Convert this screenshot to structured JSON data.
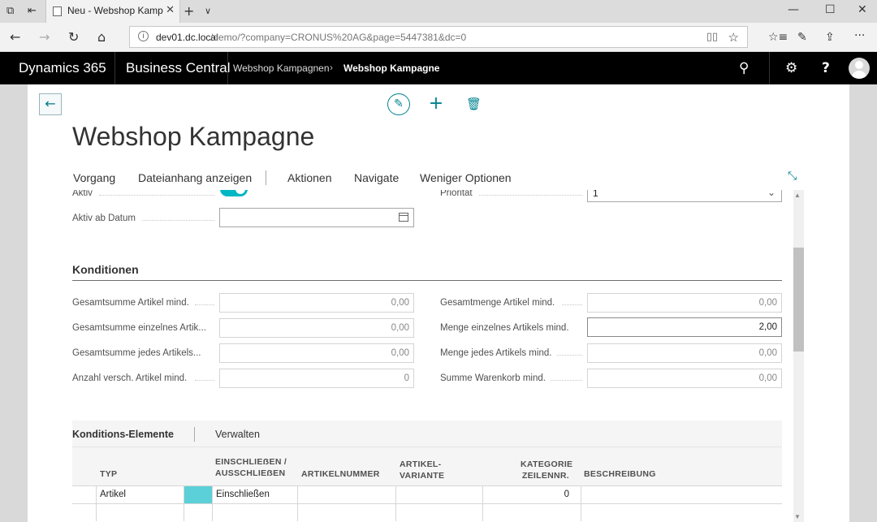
{
  "browser": {
    "tab_title": "Neu - Webshop Kampagne",
    "url_host": "dev01.dc.local",
    "url_path": "/demo/?company=CRONUS%20AG&page=5447381&dc=0"
  },
  "app": {
    "product": "Dynamics 365",
    "app_name": "Business Central",
    "breadcrumb": [
      "Webshop Kampagnen",
      "Webshop Kampagne"
    ]
  },
  "page": {
    "title": "Webshop Kampagne",
    "menu": [
      "Vorgang",
      "Dateianhang anzeigen",
      "Aktionen",
      "Navigate",
      "Weniger Optionen"
    ]
  },
  "general": {
    "aktiv_label": "Aktiv",
    "aktiv_value": true,
    "aktiv_ab_label": "Aktiv ab Datum",
    "aktiv_ab_value": "",
    "prioritaet_label": "Priorität",
    "prioritaet_value": "1"
  },
  "konditionen": {
    "title": "Konditionen",
    "left": [
      {
        "label": "Gesamtsumme Artikel mind.",
        "value": "0,00"
      },
      {
        "label": "Gesamtsumme einzelnes Artik...",
        "value": "0,00"
      },
      {
        "label": "Gesamtsumme jedes Artikels...",
        "value": "0,00"
      },
      {
        "label": "Anzahl versch. Artikel mind.",
        "value": "0"
      }
    ],
    "right": [
      {
        "label": "Gesamtmenge Artikel mind.",
        "value": "0,00"
      },
      {
        "label": "Menge einzelnes Artikels mind.",
        "value": "2,00"
      },
      {
        "label": "Menge jedes Artikels mind.",
        "value": "0,00"
      },
      {
        "label": "Summe Warenkorb mind.",
        "value": "0,00"
      }
    ]
  },
  "elemente": {
    "title": "Konditions-Elemente",
    "manage": "Verwalten",
    "columns": {
      "typ": "TYP",
      "einschliessen_1": "EINSCHLIEẞEN /",
      "einschliessen_2": "AUSSCHLIEẞEN",
      "artikelnummer": "ARTIKELNUMMER",
      "variante_1": "ARTIKEL-",
      "variante_2": "VARIANTE",
      "kategorie_1": "KATEGORIE",
      "kategorie_2": "ZEILENNR.",
      "beschreibung": "BESCHREIBUNG"
    },
    "rows": [
      {
        "typ": "Artikel",
        "einschliessen": "Einschließen",
        "artikelnummer": "",
        "variante": "",
        "kategorie": "0",
        "beschreibung": ""
      }
    ]
  },
  "colors": {
    "accent": "#00838f",
    "toggle_on": "#00b7c3",
    "nav_bg": "#000000"
  }
}
